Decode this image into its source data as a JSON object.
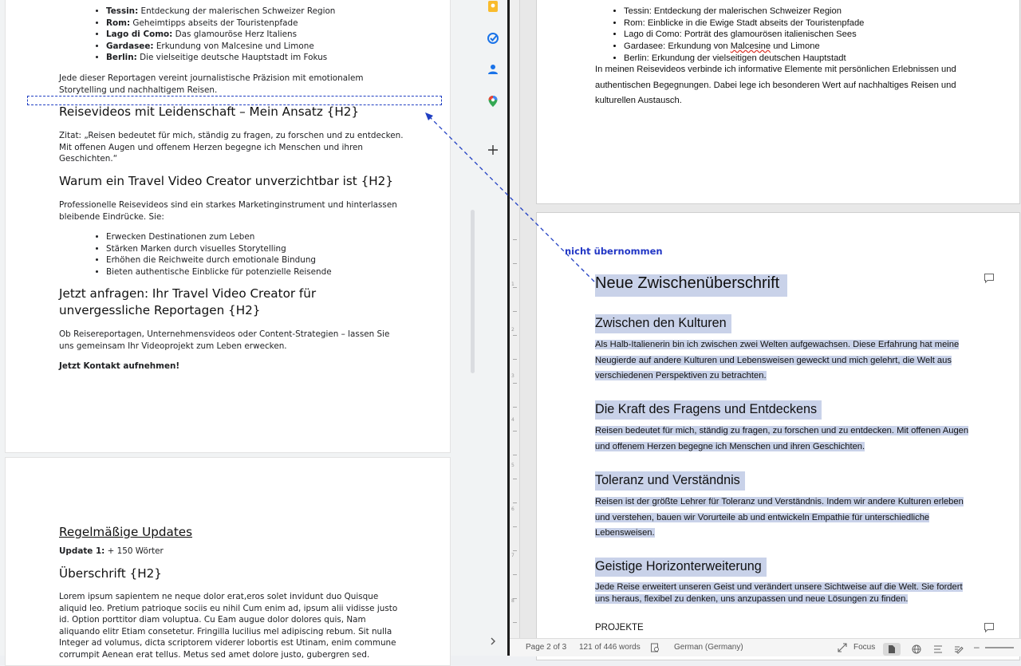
{
  "left_doc": {
    "bullets_top": [
      {
        "bold": "Tessin:",
        "text": " Entdeckung der malerischen Schweizer Region"
      },
      {
        "bold": "Rom:",
        "text": " Geheimtipps abseits der Touristenpfade"
      },
      {
        "bold": "Lago di Como:",
        "text": " Das glamouröse Herz Italiens"
      },
      {
        "bold": "Gardasee:",
        "text": " Erkundung von Malcesine und Limone"
      },
      {
        "bold": "Berlin:",
        "text": " Die vielseitige deutsche Hauptstadt im Fokus"
      }
    ],
    "para_reportagen": "Jede dieser Reportagen vereint journalistische Präzision mit emotionalem Storytelling und nachhaltigem Reisen.",
    "h2_leidenschaft": "Reisevideos mit Leidenschaft – Mein Ansatz {H2}",
    "para_zitat": "Zitat: „Reisen bedeutet für mich, ständig zu fragen, zu forschen und zu entdecken. Mit offenen Augen und offenem Herzen begegne ich Menschen und ihren Geschichten.“",
    "h2_warum": "Warum ein Travel Video Creator unverzichtbar ist {H2}",
    "para_professionell": "Professionelle Reisevideos sind ein starkes Marketinginstrument und hinterlassen bleibende Eindrücke. Sie:",
    "bullets_mid": [
      "Erwecken Destinationen zum Leben",
      "Stärken Marken durch visuelles Storytelling",
      "Erhöhen die Reichweite durch emotionale Bindung",
      "Bieten authentische Einblicke für potenzielle Reisende"
    ],
    "h2_anfragen": "Jetzt anfragen: Ihr Travel Video Creator für unvergessliche Reportagen {H2}",
    "para_ob": "Ob Reisereportagen, Unternehmensvideos oder Content-Strategien – lassen Sie uns gemeinsam Ihr Videoprojekt zum Leben erwecken.",
    "cta": "Jetzt Kontakt aufnehmen!",
    "updates_heading": "Regelmäßige Updates",
    "update1_label": "Update 1:",
    "update1_value": " + 150 Wörter",
    "h2_ueberschrift": "Überschrift {H2}",
    "lorem": "Lorem ipsum sapientem ne neque dolor erat,eros solet invidunt duo Quisque aliquid leo. Pretium patrioque sociis eu nihil Cum enim ad, ipsum alii vidisse justo id. Option porttitor diam voluptua. Cu Eam augue dolor dolores quis, Nam aliquando elitr Etiam consetetur. Fringilla lucilius mel adipiscing rebum. Sit nulla Integer ad volumus, dicta scriptorem viderer lobortis est Utinam, enim commune corrumpit Aenean erat tellus. Metus sed amet dolore justo, gubergren sed."
  },
  "strip": {
    "icons": [
      "keep-icon",
      "tasks-icon",
      "contacts-icon",
      "maps-icon",
      "add-icon",
      "expand-icon"
    ],
    "colors": {
      "keep": "#f9bb2d",
      "tasks": "#1a73e8",
      "contacts": "#1a73e8",
      "maps": "#34a853"
    }
  },
  "right_doc": {
    "bullets_top": [
      "Tessin: Entdeckung der malerischen Schweizer Region",
      "Rom: Einblicke in die Ewige Stadt abseits der Touristenpfade",
      "Lago di Como: Porträt des glamourösen italienischen Sees",
      "Gardasee: Erkundung von Malcesine und Limone",
      "Berlin: Erkundung der vielseitigen deutschen Hauptstadt"
    ],
    "para_intro": "In meinen Reisevideos verbinde ich informative Elemente mit persönlichen Erlebnissen und authentischen Begegnungen. Dabei lege ich besonderen Wert auf nachhaltiges Reisen und kulturellen Austausch.",
    "annotation": "nicht übernommen",
    "h_neue": "Neue Zwischenüberschrift",
    "h_kulturen": "Zwischen den Kulturen",
    "p_kulturen": "Als Halb-Italienerin bin ich zwischen zwei Welten aufgewachsen. Diese Erfahrung hat meine Neugierde auf andere Kulturen und Lebensweisen geweckt und mich gelehrt, die Welt aus verschiedenen Perspektiven zu betrachten.",
    "h_kraft": "Die Kraft des Fragens und Entdeckens",
    "p_kraft": "Reisen bedeutet für mich, ständig zu fragen, zu forschen und zu entdecken. Mit offenen Augen und offenem Herzen begegne ich Menschen und ihren Geschichten.",
    "h_toleranz": "Toleranz und Verständnis",
    "p_toleranz": "Reisen ist der größte Lehrer für Toleranz und Verständnis. Indem wir andere Kulturen erleben und verstehen, bauen wir Vorurteile ab und entwickeln Empathie für unterschiedliche Lebensweisen.",
    "h_horizont": "Geistige Horizonterweiterung",
    "p_horizont": "Jede Reise erweitert unseren Geist und verändert unsere Sichtweise auf die Welt. Sie fordert uns heraus, flexibel zu denken, uns anzupassen und neue Lösungen zu finden.",
    "projekte": "PROJEKTE",
    "highlight_color": "#c9d2e9",
    "annotation_color": "#2136c5"
  },
  "ruler_numbers": [
    "1",
    "2",
    "3",
    "4",
    "5",
    "6",
    "7",
    "8"
  ],
  "status_bar": {
    "page": "Page 2 of 3",
    "words": "121 of 446 words",
    "language": "German (Germany)",
    "focus": "Focus"
  }
}
